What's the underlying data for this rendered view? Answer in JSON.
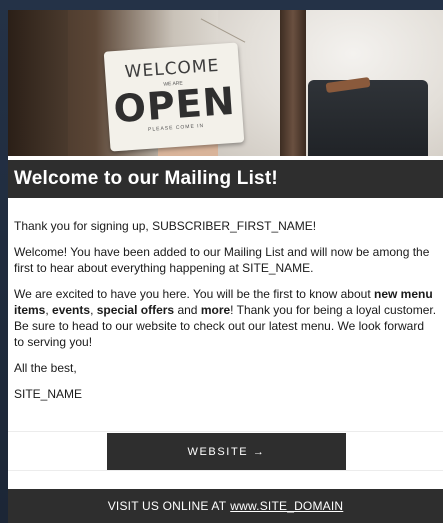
{
  "hero": {
    "sign_top": "WELCOME",
    "sign_main": "OPEN",
    "sign_small_top": "WE ARE",
    "sign_small_bottom": "PLEASE COME IN"
  },
  "header": {
    "title": "Welcome to our Mailing List!"
  },
  "body": {
    "greeting": "Thank you for signing up, SUBSCRIBER_FIRST_NAME!",
    "para1": "Welcome! You have been added to our Mailing List and will now be among the first to hear about everything happening at SITE_NAME.",
    "para2_a": "We are excited to have you here. You will be the first to know about ",
    "para2_b1": "new menu items",
    "para2_sep1": ", ",
    "para2_b2": "events",
    "para2_sep2": ", ",
    "para2_b3": "special offers",
    "para2_sep3": " and ",
    "para2_b4": "more",
    "para2_c": "! Thank you for being a loyal customer. Be sure to head to our website to check out our latest menu. We look forward to serving you!",
    "signoff": "All the best,",
    "signature": "SITE_NAME"
  },
  "button": {
    "label": "WEBSITE →"
  },
  "footer": {
    "prefix": "VISIT US ONLINE AT",
    "link": "www.SITE_DOMAIN"
  }
}
